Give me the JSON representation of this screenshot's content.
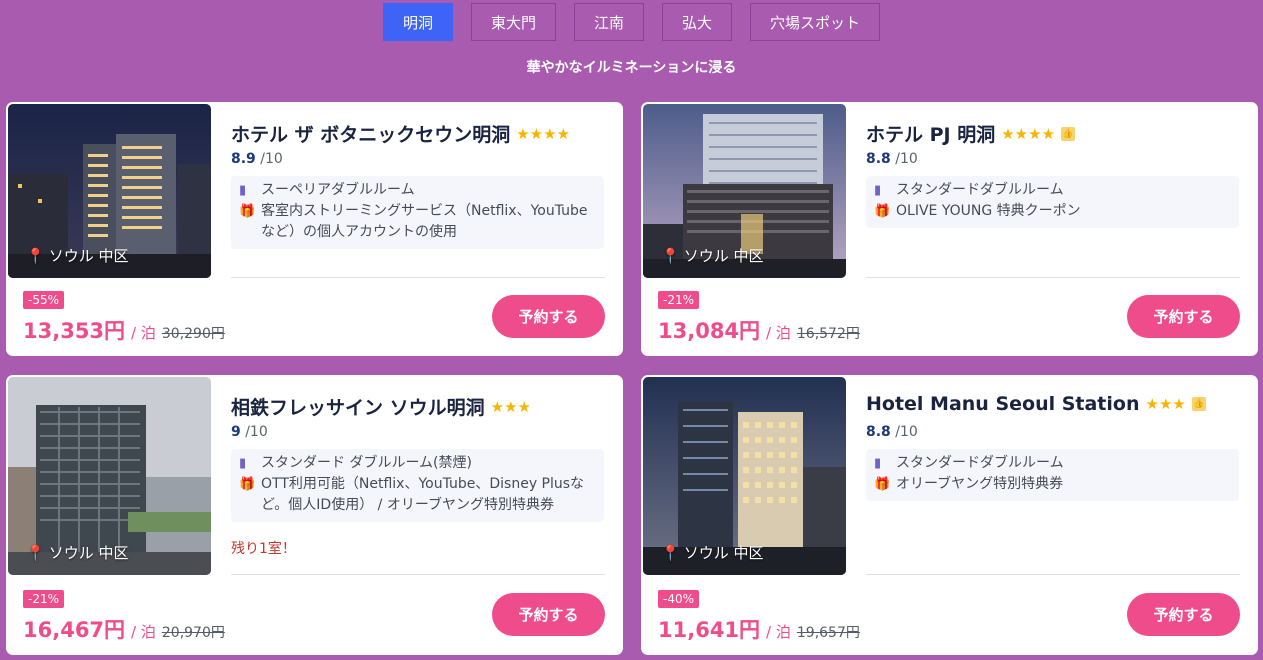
{
  "tabs": [
    {
      "label": "明洞",
      "active": true
    },
    {
      "label": "東大門"
    },
    {
      "label": "江南"
    },
    {
      "label": "弘大"
    },
    {
      "label": "穴場スポット"
    }
  ],
  "subtitle": "華やかなイルミネーションに浸る",
  "per_night": "/ 泊",
  "rating_suffix": "/10",
  "book_label": "予約する",
  "hotels": [
    {
      "name": "ホテル ザ ボタニックセウン明洞",
      "stars": "★★★★",
      "rating": "8.9",
      "room": "スーペリアダブルルーム",
      "benefit": "客室内ストリーミングサービス（Netflix、YouTubeなど）の個人アカウントの使用",
      "location": "ソウル 中区",
      "discount": "-55%",
      "price": "13,353円",
      "original_price": "30,290円"
    },
    {
      "name": "ホテル PJ 明洞",
      "stars": "★★★★",
      "rating": "8.8",
      "room": "スタンダードダブルルーム",
      "benefit": "OLIVE YOUNG 特典クーポン",
      "location": "ソウル 中区",
      "discount": "-21%",
      "price": "13,084円",
      "original_price": "16,572円"
    },
    {
      "name": "相鉄フレッサイン ソウル明洞",
      "stars": "★★★",
      "rating": "9",
      "room": "スタンダード ダブルルーム(禁煙)",
      "benefit": "OTT利用可能（Netflix、YouTube、Disney Plusなど。個人ID使用） / オリーブヤング特別特典券",
      "note": "残り1室！",
      "location": "ソウル 中区",
      "discount": "-21%",
      "price": "16,467円",
      "original_price": "20,970円"
    },
    {
      "name": "Hotel Manu Seoul Station",
      "stars": "★★★",
      "rating": "8.8",
      "room": "スタンダードダブルルーム",
      "benefit": "オリーブヤング特別特典券",
      "location": "ソウル 中区",
      "discount": "-40%",
      "price": "11,641円",
      "original_price": "19,657円"
    }
  ],
  "colors": {
    "background": "#a95bb0",
    "active_tab": "#3d64f6",
    "accent_pink": "#ef4c8b",
    "star": "#f7b500"
  }
}
